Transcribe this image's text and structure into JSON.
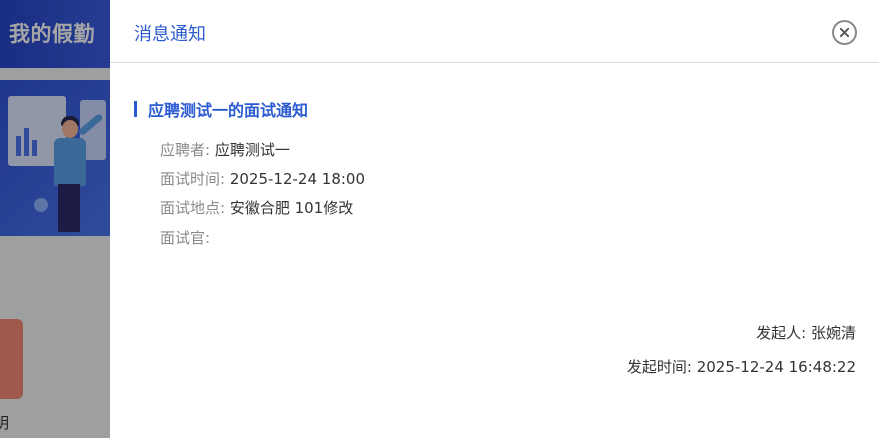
{
  "background": {
    "header_title": "我的假勤",
    "bottom_label": "明"
  },
  "drawer": {
    "title": "消息通知",
    "close_icon": "close-icon"
  },
  "notice": {
    "title": "应聘测试一的面试通知",
    "fields": [
      {
        "label": "应聘者: ",
        "value": "应聘测试一"
      },
      {
        "label": "面试时间: ",
        "value": "2025-12-24 18:00"
      },
      {
        "label": "面试地点: ",
        "value": "安徽合肥 101修改"
      },
      {
        "label": "面试官: ",
        "value": ""
      }
    ],
    "sender_label": "发起人: ",
    "sender_value": "张婉清",
    "sent_time_label": "发起时间: ",
    "sent_time_value": "2025-12-24 16:48:22"
  },
  "colors": {
    "accent": "#2c5bd1",
    "label_gray": "#8a8a8a",
    "text": "#333333"
  }
}
